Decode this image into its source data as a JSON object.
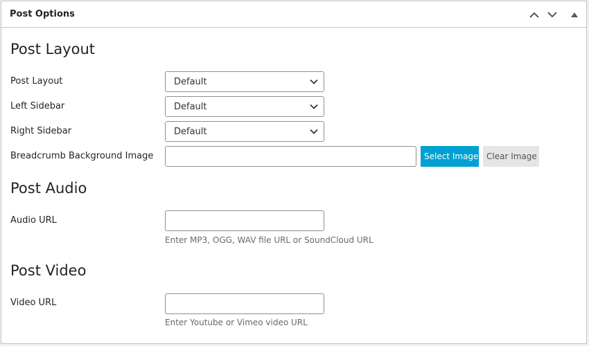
{
  "header": {
    "title": "Post Options",
    "icons": [
      "chevron-up-icon",
      "chevron-down-icon",
      "collapse-triangle-icon"
    ]
  },
  "post_layout": {
    "heading": "Post Layout",
    "fields": {
      "post_layout": {
        "label": "Post Layout",
        "value": "Default"
      },
      "left_sidebar": {
        "label": "Left Sidebar",
        "value": "Default"
      },
      "right_sidebar": {
        "label": "Right Sidebar",
        "value": "Default"
      },
      "breadcrumb_bg": {
        "label": "Breadcrumb Background Image",
        "value": "",
        "select_label": "Select Image",
        "clear_label": "Clear Image"
      }
    }
  },
  "post_audio": {
    "heading": "Post Audio",
    "audio_url": {
      "label": "Audio URL",
      "value": "",
      "description": "Enter MP3, OGG, WAV file URL or SoundCloud URL"
    }
  },
  "post_video": {
    "heading": "Post Video",
    "video_url": {
      "label": "Video URL",
      "value": "",
      "description": "Enter Youtube or Vimeo video URL"
    }
  },
  "colors": {
    "select_button": "#00a0d2",
    "clear_button": "#e5e5e5",
    "border": "#c3c4c7"
  }
}
